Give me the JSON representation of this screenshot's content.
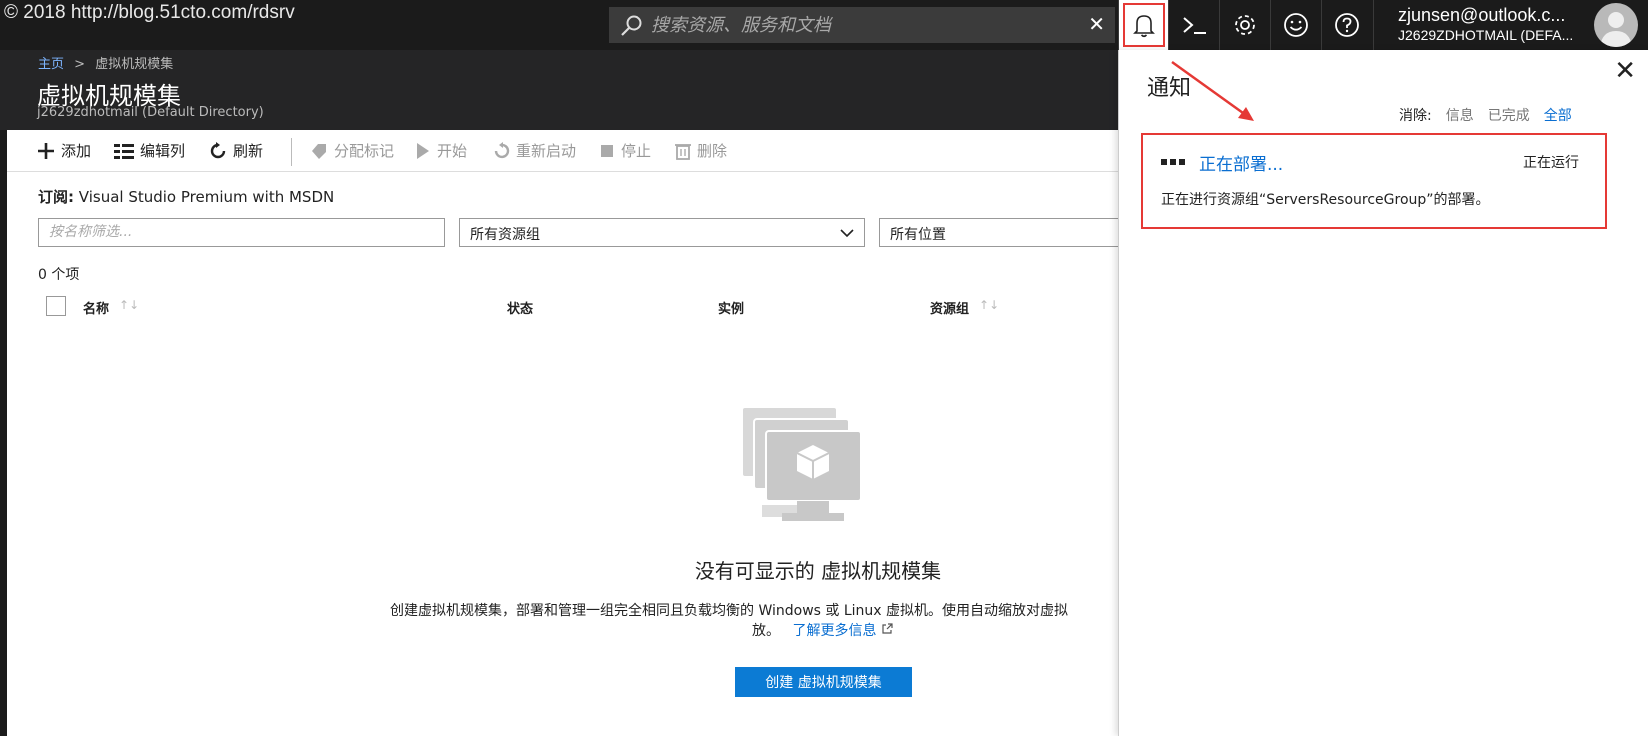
{
  "watermark": "© 2018 http://blog.51cto.com/rdsrv",
  "search": {
    "placeholder": "搜索资源、服务和文档",
    "clear": "✕"
  },
  "topbar_icons": [
    "bell-icon",
    "cloud-shell-icon",
    "gear-icon",
    "smiley-icon",
    "help-icon"
  ],
  "user": {
    "email": "zjunsen@outlook.c...",
    "directory": "J2629ZDHOTMAIL (DEFA..."
  },
  "breadcrumb": {
    "home": "主页",
    "sep": ">",
    "current": "虚拟机规模集"
  },
  "header": {
    "title": "虚拟机规模集",
    "subtitle": "j2629zdhotmail (Default Directory)"
  },
  "toolbar": {
    "add": "添加",
    "edit_columns": "编辑列",
    "refresh": "刷新",
    "assign_tags": "分配标记",
    "start": "开始",
    "restart": "重新启动",
    "stop": "停止",
    "delete": "删除"
  },
  "subscription": {
    "label": "订阅:",
    "value": "Visual Studio Premium with MSDN"
  },
  "filters": {
    "name_placeholder": "按名称筛选...",
    "resource_group": "所有资源组",
    "location": "所有位置"
  },
  "count": "0 个项",
  "columns": [
    "名称",
    "状态",
    "实例",
    "资源组"
  ],
  "empty": {
    "title": "没有可显示的 虚拟机规模集",
    "desc": "创建虚拟机规模集，部署和管理一组完全相同且负载均衡的 Windows 或 Linux 虚拟机。使用自动缩放对虚拟",
    "desc2": "放。",
    "learn_more": "了解更多信息",
    "create_button": "创建 虚拟机规模集"
  },
  "notifications": {
    "title": "通知",
    "close": "✕",
    "dismiss_label": "消除:",
    "dismiss_info": "信息",
    "dismiss_completed": "已完成",
    "dismiss_all": "全部",
    "item": {
      "title": "正在部署...",
      "status": "正在运行",
      "desc": "正在进行资源组“ServersResourceGroup”的部署。"
    }
  },
  "colors": {
    "accent": "#0c7bd4",
    "highlight": "#e53935",
    "topbar": "#1b1b1b"
  }
}
